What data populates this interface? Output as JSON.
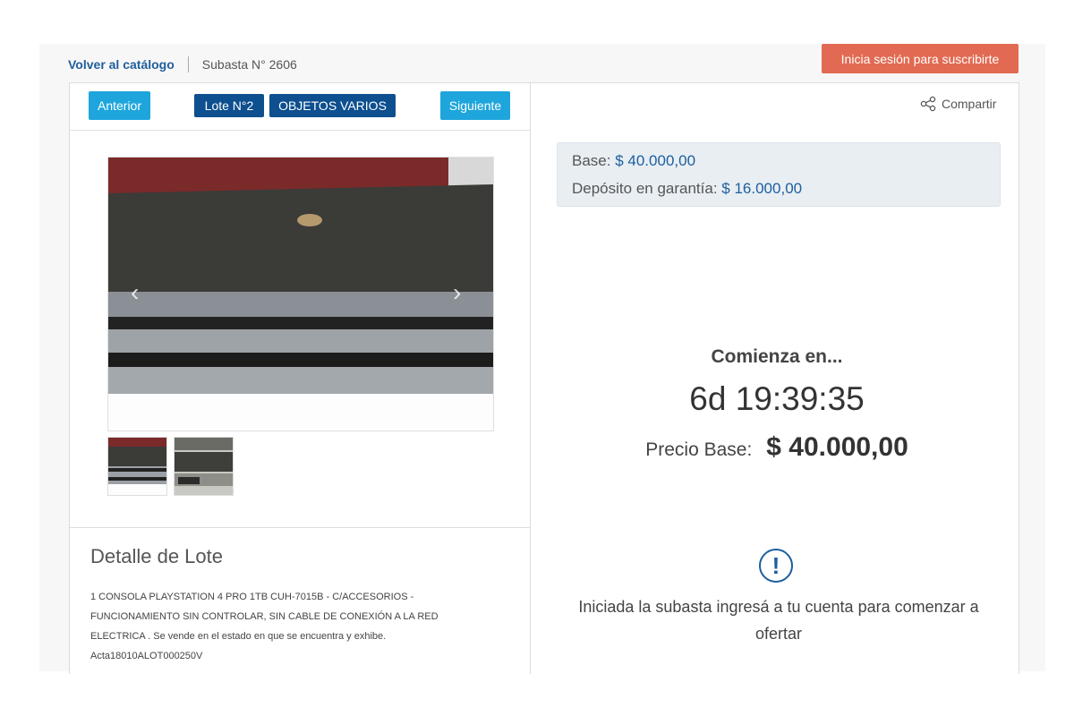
{
  "header": {
    "back_label": "Volver al catálogo",
    "auction_label": "Subasta N° 2606",
    "login_button": "Inicia sesión para suscribirte"
  },
  "lot_nav": {
    "prev_label": "Anterior",
    "lot_label": "Lote N°2",
    "category_label": "OBJETOS VARIOS",
    "next_label": "Siguiente"
  },
  "share": {
    "label": "Compartir",
    "icon": "share-icon"
  },
  "prices": {
    "base_label": "Base:",
    "base_value": "$ 40.000,00",
    "deposit_label": "Depósito en garantía:",
    "deposit_value": "$ 16.000,00"
  },
  "countdown": {
    "label": "Comienza en...",
    "time": "6d 19:39:35",
    "base_label": "Precio Base:",
    "base_value": "$ 40.000,00"
  },
  "notice": {
    "icon": "info-icon",
    "text": "Iniciada la subasta ingresá a tu cuenta para comenzar a ofertar"
  },
  "detail": {
    "title": "Detalle de Lote",
    "text": "1 CONSOLA PLAYSTATION 4 PRO 1TB CUH-7015B - C/ACCESORIOS - FUNCIONAMIENTO SIN CONTROLAR, SIN CABLE DE CONEXIÓN A LA RED ELECTRICA . Se vende en el estado en que se encuentra y exhibe. Acta18010ALOT000250V"
  },
  "colors": {
    "accent_blue": "#1ea6dc",
    "chip_blue": "#0d4f8f",
    "login_orange": "#e26a52",
    "link_blue": "#1f5e9c"
  }
}
